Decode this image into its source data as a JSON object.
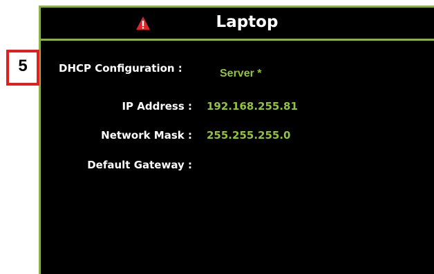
{
  "step_badge": "5",
  "header": {
    "title": "Laptop",
    "icon": "warning-icon",
    "icon_color": "#d9262b"
  },
  "fields": {
    "dhcp": {
      "label": "DHCP Configuration :",
      "value": "Server *"
    },
    "ip": {
      "label": "IP Address :",
      "value": "192.168.255.81"
    },
    "mask": {
      "label": "Network Mask :",
      "value": "255.255.255.0"
    },
    "gateway": {
      "label": "Default Gateway :",
      "value": ""
    }
  },
  "colors": {
    "accent_border": "#8db04b",
    "value_text": "#93c23c",
    "badge_border": "#e0201e"
  }
}
